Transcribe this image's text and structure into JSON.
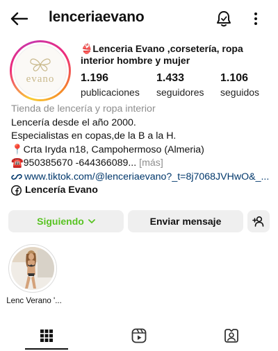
{
  "header": {
    "username": "lenceriaevano",
    "icons": {
      "back": "arrow-left-icon",
      "bell": "bell-icon",
      "more": "more-vertical-icon"
    }
  },
  "profile": {
    "avatar_text": "evano",
    "full_name": "👙Lenceria Evano ,corsetería, ropa interior hombre y mujer",
    "stats": [
      {
        "value": "1.196",
        "label": "publicaciones"
      },
      {
        "value": "1.433",
        "label": "seguidores"
      },
      {
        "value": "1.106",
        "label": "seguidos"
      }
    ]
  },
  "bio": {
    "category": "Tienda de lencería y ropa interior",
    "lines": [
      "Lencería desde el año 2000.",
      "Especialistas en copas,de la B a la H.",
      "📍Crta Iryda n18, Campohermoso (Almeria)"
    ],
    "phone": "☎️950385670 -644366089...",
    "more": " [más]",
    "link": "www.tiktok.com/@lenceriaevano?_t=8j7068JVHwO&_...",
    "facebook_name": "Lencería Evano"
  },
  "actions": {
    "following_label": "Siguiendo",
    "message_label": "Enviar mensaje"
  },
  "highlights": [
    {
      "label": "Lenc Verano '..."
    }
  ],
  "tabs": [
    "grid-icon",
    "reels-icon",
    "tagged-icon"
  ],
  "colors": {
    "following": "#58c322",
    "link": "#00376b",
    "button_bg": "#efefef"
  }
}
